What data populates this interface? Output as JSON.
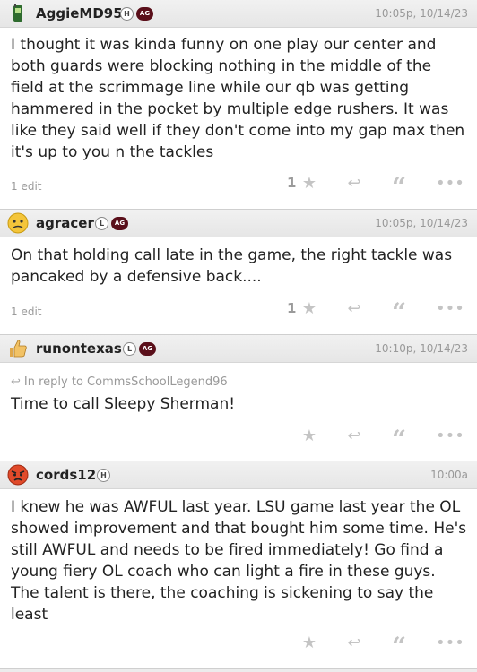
{
  "posts": [
    {
      "username": "AggieMD95",
      "badges": [
        "H",
        "AG"
      ],
      "timestamp": "10:05p, 10/14/23",
      "body": "I thought it was kinda funny on one play our center and both guards were blocking nothing in the middle of the field at the scrimmage line while our qb was getting hammered in the pocket by multiple edge rushers. It was like they said well if they don't come into my gap max then it's up to you n the tackles",
      "edit_note": "1 edit",
      "like_count": "1",
      "avatar_icon": "phone-icon"
    },
    {
      "username": "agracer",
      "badges": [
        "L",
        "AG"
      ],
      "timestamp": "10:05p, 10/14/23",
      "body": "On that holding call late in the game, the right tackle was pancaked by a defensive back....",
      "edit_note": "1 edit",
      "like_count": "1",
      "avatar_icon": "worried-face-icon"
    },
    {
      "username": "runontexas",
      "badges": [
        "L",
        "AG"
      ],
      "timestamp": "10:10p, 10/14/23",
      "reply_to": "In reply to CommsSchoolLegend96",
      "body": "Time to call Sleepy Sherman!",
      "avatar_icon": "thumbs-up-icon"
    },
    {
      "username": "cords12",
      "badges": [
        "H"
      ],
      "timestamp": "10:00a",
      "body": "I knew he was AWFUL last year. LSU game last year the OL showed improvement and that bought him some time. He's still AWFUL and needs to be fired immediately! Go find a young fiery OL coach who can light a fire in these guys. The talent is there, the coaching is sickening to say the least",
      "avatar_icon": "angry-face-icon"
    }
  ],
  "colors": {
    "ag_badge": "#5a0f1a",
    "action_icon": "#c4c4c4",
    "header_bg": "#ececec"
  }
}
